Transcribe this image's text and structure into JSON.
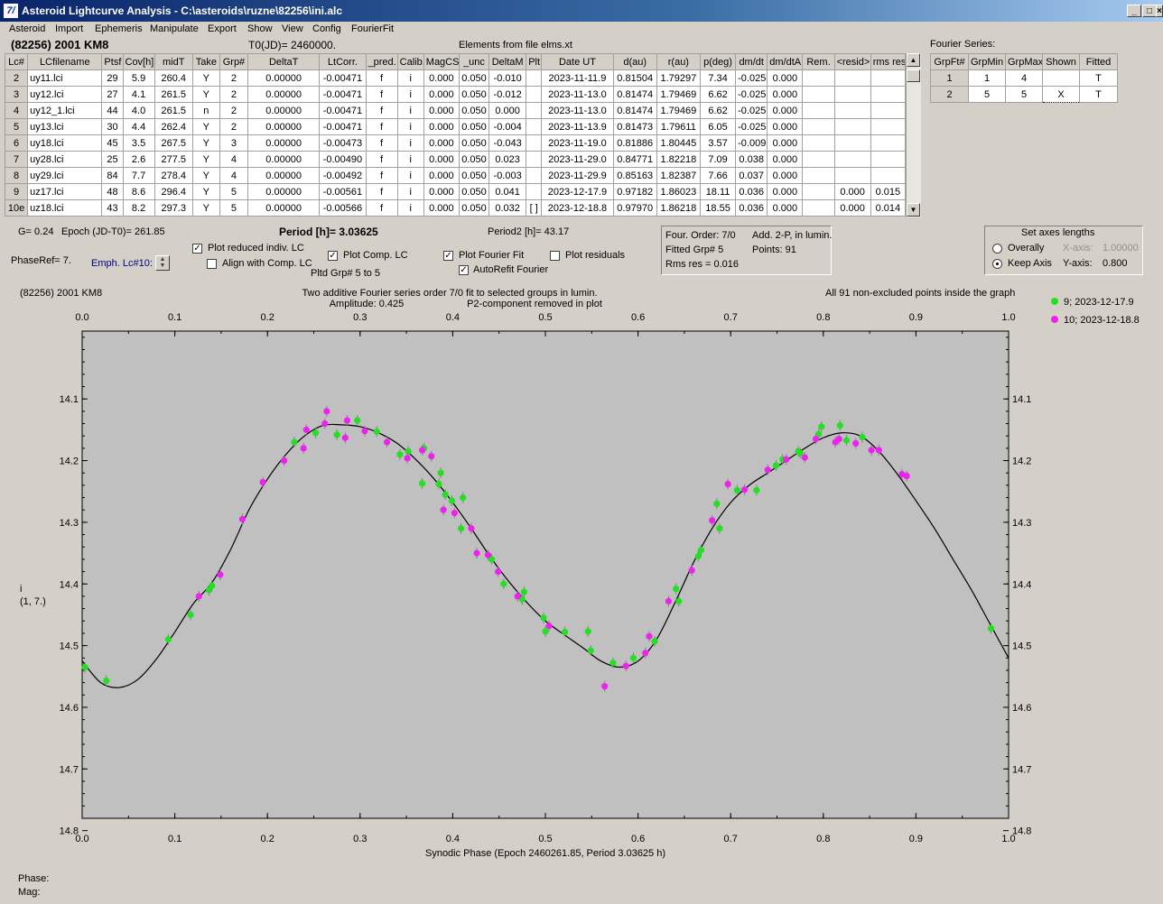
{
  "window": {
    "title": "Asteroid Lightcurve Analysis - C:\\asteroids\\ruzne\\82256\\ini.alc",
    "logo": "7/"
  },
  "menu": [
    "Asteroid",
    "Import",
    "Ephemeris",
    "Manipulate",
    "Export",
    "Show",
    "View",
    "Config",
    "FourierFit"
  ],
  "header": {
    "object": "(82256) 2001 KM8",
    "t0": "T0(JD)= 2460000.",
    "elements": "Elements from file elms.xt"
  },
  "lc_table": {
    "columns": [
      "Lc#",
      "LCfilename",
      "Ptsf",
      "Cov[h]",
      "midT",
      "Take",
      "Grp#",
      "DeltaT",
      "LtCorr.",
      "_pred.",
      "Calib.",
      "MagCS",
      "_unc",
      "DeltaM",
      "Plt",
      "Date UT",
      "d(au)",
      "r(au)",
      "p(deg)",
      "dm/dt",
      "dm/dtA",
      "Rem.",
      "<resid>",
      "rms res"
    ],
    "rows": [
      [
        "2",
        "uy11.lci",
        "29",
        "5.9",
        "260.4",
        "Y",
        "2",
        "0.00000",
        "-0.00471",
        "f",
        "i",
        "0.000",
        "0.050",
        "-0.010",
        "",
        "2023-11-11.9",
        "0.81504",
        "1.79297",
        "7.34",
        "-0.025",
        "0.000",
        "",
        "",
        ""
      ],
      [
        "3",
        "uy12.lci",
        "27",
        "4.1",
        "261.5",
        "Y",
        "2",
        "0.00000",
        "-0.00471",
        "f",
        "i",
        "0.000",
        "0.050",
        "-0.012",
        "",
        "2023-11-13.0",
        "0.81474",
        "1.79469",
        "6.62",
        "-0.025",
        "0.000",
        "",
        "",
        ""
      ],
      [
        "4",
        "uy12_1.lci",
        "44",
        "4.0",
        "261.5",
        "n",
        "2",
        "0.00000",
        "-0.00471",
        "f",
        "i",
        "0.000",
        "0.050",
        "0.000",
        "",
        "2023-11-13.0",
        "0.81474",
        "1.79469",
        "6.62",
        "-0.025",
        "0.000",
        "",
        "",
        ""
      ],
      [
        "5",
        "uy13.lci",
        "30",
        "4.4",
        "262.4",
        "Y",
        "2",
        "0.00000",
        "-0.00471",
        "f",
        "i",
        "0.000",
        "0.050",
        "-0.004",
        "",
        "2023-11-13.9",
        "0.81473",
        "1.79611",
        "6.05",
        "-0.025",
        "0.000",
        "",
        "",
        ""
      ],
      [
        "6",
        "uy18.lci",
        "45",
        "3.5",
        "267.5",
        "Y",
        "3",
        "0.00000",
        "-0.00473",
        "f",
        "i",
        "0.000",
        "0.050",
        "-0.043",
        "",
        "2023-11-19.0",
        "0.81886",
        "1.80445",
        "3.57",
        "-0.009",
        "0.000",
        "",
        "",
        ""
      ],
      [
        "7",
        "uy28.lci",
        "25",
        "2.6",
        "277.5",
        "Y",
        "4",
        "0.00000",
        "-0.00490",
        "f",
        "i",
        "0.000",
        "0.050",
        "0.023",
        "",
        "2023-11-29.0",
        "0.84771",
        "1.82218",
        "7.09",
        "0.038",
        "0.000",
        "",
        "",
        ""
      ],
      [
        "8",
        "uy29.lci",
        "84",
        "7.7",
        "278.4",
        "Y",
        "4",
        "0.00000",
        "-0.00492",
        "f",
        "i",
        "0.000",
        "0.050",
        "-0.003",
        "",
        "2023-11-29.9",
        "0.85163",
        "1.82387",
        "7.66",
        "0.037",
        "0.000",
        "",
        "",
        ""
      ],
      [
        "9",
        "uz17.lci",
        "48",
        "8.6",
        "296.4",
        "Y",
        "5",
        "0.00000",
        "-0.00561",
        "f",
        "i",
        "0.000",
        "0.050",
        "0.041",
        "",
        "2023-12-17.9",
        "0.97182",
        "1.86023",
        "18.11",
        "0.036",
        "0.000",
        "",
        "0.000",
        "0.015"
      ],
      [
        "10e",
        "uz18.lci",
        "43",
        "8.2",
        "297.3",
        "Y",
        "5",
        "0.00000",
        "-0.00566",
        "f",
        "i",
        "0.000",
        "0.050",
        "0.032",
        "[ ]",
        "2023-12-18.8",
        "0.97970",
        "1.86218",
        "18.55",
        "0.036",
        "0.000",
        "",
        "0.000",
        "0.014"
      ]
    ]
  },
  "fourier_series": {
    "title": "Fourier Series:",
    "columns": [
      "GrpFt#",
      "GrpMin",
      "GrpMax",
      "Shown",
      "Fitted"
    ],
    "rows": [
      [
        "1",
        "1",
        "4",
        "",
        "T"
      ],
      [
        "2",
        "5",
        "5",
        "X",
        "T"
      ]
    ]
  },
  "info": {
    "g": "G= 0.24",
    "epoch": "Epoch (JD-T0)= 261.85",
    "period": "Period [h]= 3.03625",
    "period2": "Period2 [h]= 43.17",
    "phaseref": "PhaseRef= 7.",
    "emph": "Emph. Lc#10:",
    "pltd_grp": "Pltd Grp#  5  to  5"
  },
  "options": {
    "plot_reduced": {
      "label": "Plot reduced indiv. LC",
      "checked": true
    },
    "align_comp": {
      "label": "Align with Comp. LC",
      "checked": false
    },
    "plot_comp": {
      "label": "Plot Comp. LC",
      "checked": true
    },
    "plot_fourier": {
      "label": "Plot Fourier Fit",
      "checked": true
    },
    "autorefit": {
      "label": "AutoRefit Fourier",
      "checked": true
    },
    "plot_residuals": {
      "label": "Plot residuals",
      "checked": false
    }
  },
  "fit_box": {
    "order": "Four. Order:  7/0",
    "add": "Add. 2-P, in lumin.",
    "fitted": "Fitted Grp# 5",
    "points": "Points: 91",
    "rms": "Rms res     = 0.016"
  },
  "axes_box": {
    "title": "Set axes lengths",
    "overally": "Overally",
    "keep": "Keep Axis",
    "xaxis_label": "X-axis:",
    "xaxis_value": "1.00000",
    "yaxis_label": "Y-axis:",
    "yaxis_value": "0.800",
    "selected": "keep"
  },
  "plot_text": {
    "object": "(82256) 2001 KM8",
    "desc1": "Two additive Fourier series order 7/0 fit to selected groups in lumin.",
    "desc2": "Amplitude: 0.425",
    "desc3": "P2-component removed in plot",
    "note": "All 91 non-excluded points inside the graph"
  },
  "status": {
    "phase": "Phase:",
    "mag": "Mag:"
  },
  "colors": {
    "series1": "#22e022",
    "series2": "#ee22ee",
    "plot_bg": "#c0c0c0"
  },
  "chart_data": {
    "type": "scatter",
    "xlabel": "Synodic Phase (Epoch 2460261.85, Period 3.03625 h)",
    "ylabel": "i",
    "ylabel2": "(1, 7.)",
    "xlim": [
      0,
      1
    ],
    "ylim": [
      14.8,
      14.0
    ],
    "y_inverted": true,
    "xticks": [
      0.0,
      0.1,
      0.2,
      0.3,
      0.4,
      0.5,
      0.6,
      0.7,
      0.8,
      0.9,
      1.0
    ],
    "xtick_labels": [
      "0.0",
      "0.1",
      "0.2",
      "0.3",
      "0.4",
      "0.5",
      "0.6",
      "0.7",
      "0.8",
      "0.9",
      "1.0"
    ],
    "yticks": [
      14.1,
      14.2,
      14.3,
      14.4,
      14.5,
      14.6,
      14.7,
      14.8
    ],
    "ytick_labels": [
      "14.1",
      "14.2",
      "14.3",
      "14.4",
      "14.5",
      "14.6",
      "14.7",
      "14.8"
    ],
    "legend": "top-right",
    "series": [
      {
        "name": "9; 2023-12-17.9",
        "color": "#22e022",
        "points": [
          [
            0.003,
            14.535
          ],
          [
            0.026,
            14.557
          ],
          [
            0.093,
            14.49
          ],
          [
            0.117,
            14.45
          ],
          [
            0.137,
            14.41
          ],
          [
            0.14,
            14.403
          ],
          [
            0.229,
            14.17
          ],
          [
            0.252,
            14.155
          ],
          [
            0.275,
            14.158
          ],
          [
            0.297,
            14.135
          ],
          [
            0.318,
            14.153
          ],
          [
            0.343,
            14.19
          ],
          [
            0.352,
            14.185
          ],
          [
            0.367,
            14.237
          ],
          [
            0.369,
            14.18
          ],
          [
            0.385,
            14.238
          ],
          [
            0.387,
            14.22
          ],
          [
            0.392,
            14.255
          ],
          [
            0.399,
            14.265
          ],
          [
            0.409,
            14.31
          ],
          [
            0.411,
            14.26
          ],
          [
            0.442,
            14.36
          ],
          [
            0.455,
            14.4
          ],
          [
            0.475,
            14.425
          ],
          [
            0.477,
            14.413
          ],
          [
            0.498,
            14.455
          ],
          [
            0.5,
            14.477
          ],
          [
            0.521,
            14.478
          ],
          [
            0.546,
            14.477
          ],
          [
            0.549,
            14.508
          ],
          [
            0.573,
            14.528
          ],
          [
            0.595,
            14.52
          ],
          [
            0.618,
            14.493
          ],
          [
            0.641,
            14.408
          ],
          [
            0.644,
            14.428
          ],
          [
            0.665,
            14.355
          ],
          [
            0.668,
            14.345
          ],
          [
            0.685,
            14.27
          ],
          [
            0.688,
            14.31
          ],
          [
            0.707,
            14.248
          ],
          [
            0.728,
            14.248
          ],
          [
            0.749,
            14.208
          ],
          [
            0.756,
            14.198
          ],
          [
            0.773,
            14.185
          ],
          [
            0.775,
            14.188
          ],
          [
            0.795,
            14.157
          ],
          [
            0.798,
            14.145
          ],
          [
            0.818,
            14.143
          ],
          [
            0.825,
            14.167
          ],
          [
            0.842,
            14.162
          ],
          [
            0.981,
            14.472
          ]
        ]
      },
      {
        "name": "10; 2023-12-18.8",
        "color": "#ee22ee",
        "points": [
          [
            0.126,
            14.42
          ],
          [
            0.149,
            14.385
          ],
          [
            0.173,
            14.295
          ],
          [
            0.195,
            14.235
          ],
          [
            0.218,
            14.2
          ],
          [
            0.239,
            14.18
          ],
          [
            0.242,
            14.15
          ],
          [
            0.262,
            14.14
          ],
          [
            0.264,
            14.12
          ],
          [
            0.284,
            14.163
          ],
          [
            0.286,
            14.135
          ],
          [
            0.305,
            14.152
          ],
          [
            0.329,
            14.17
          ],
          [
            0.351,
            14.196
          ],
          [
            0.367,
            14.183
          ],
          [
            0.377,
            14.193
          ],
          [
            0.39,
            14.28
          ],
          [
            0.402,
            14.285
          ],
          [
            0.42,
            14.31
          ],
          [
            0.426,
            14.35
          ],
          [
            0.438,
            14.353
          ],
          [
            0.449,
            14.38
          ],
          [
            0.47,
            14.42
          ],
          [
            0.504,
            14.468
          ],
          [
            0.564,
            14.566
          ],
          [
            0.587,
            14.533
          ],
          [
            0.608,
            14.512
          ],
          [
            0.612,
            14.485
          ],
          [
            0.633,
            14.428
          ],
          [
            0.658,
            14.378
          ],
          [
            0.68,
            14.297
          ],
          [
            0.697,
            14.238
          ],
          [
            0.715,
            14.247
          ],
          [
            0.74,
            14.215
          ],
          [
            0.76,
            14.198
          ],
          [
            0.78,
            14.195
          ],
          [
            0.792,
            14.165
          ],
          [
            0.813,
            14.17
          ],
          [
            0.817,
            14.165
          ],
          [
            0.835,
            14.172
          ],
          [
            0.852,
            14.183
          ],
          [
            0.86,
            14.183
          ],
          [
            0.885,
            14.222
          ],
          [
            0.89,
            14.225
          ]
        ]
      }
    ],
    "fit_curve": [
      [
        0.0,
        14.525
      ],
      [
        0.02,
        14.56
      ],
      [
        0.04,
        14.568
      ],
      [
        0.06,
        14.555
      ],
      [
        0.08,
        14.522
      ],
      [
        0.1,
        14.478
      ],
      [
        0.12,
        14.432
      ],
      [
        0.14,
        14.398
      ],
      [
        0.16,
        14.345
      ],
      [
        0.18,
        14.28
      ],
      [
        0.2,
        14.23
      ],
      [
        0.22,
        14.19
      ],
      [
        0.24,
        14.16
      ],
      [
        0.26,
        14.143
      ],
      [
        0.28,
        14.142
      ],
      [
        0.3,
        14.145
      ],
      [
        0.32,
        14.155
      ],
      [
        0.34,
        14.172
      ],
      [
        0.36,
        14.198
      ],
      [
        0.38,
        14.23
      ],
      [
        0.4,
        14.268
      ],
      [
        0.42,
        14.31
      ],
      [
        0.44,
        14.355
      ],
      [
        0.46,
        14.395
      ],
      [
        0.48,
        14.43
      ],
      [
        0.5,
        14.46
      ],
      [
        0.52,
        14.482
      ],
      [
        0.54,
        14.503
      ],
      [
        0.56,
        14.525
      ],
      [
        0.58,
        14.535
      ],
      [
        0.6,
        14.525
      ],
      [
        0.62,
        14.49
      ],
      [
        0.64,
        14.43
      ],
      [
        0.66,
        14.365
      ],
      [
        0.68,
        14.31
      ],
      [
        0.7,
        14.268
      ],
      [
        0.72,
        14.24
      ],
      [
        0.74,
        14.22
      ],
      [
        0.76,
        14.2
      ],
      [
        0.78,
        14.18
      ],
      [
        0.8,
        14.163
      ],
      [
        0.82,
        14.155
      ],
      [
        0.84,
        14.16
      ],
      [
        0.86,
        14.185
      ],
      [
        0.88,
        14.222
      ],
      [
        0.9,
        14.265
      ],
      [
        0.92,
        14.31
      ],
      [
        0.94,
        14.36
      ],
      [
        0.96,
        14.41
      ],
      [
        0.98,
        14.465
      ],
      [
        1.0,
        14.52
      ]
    ]
  }
}
